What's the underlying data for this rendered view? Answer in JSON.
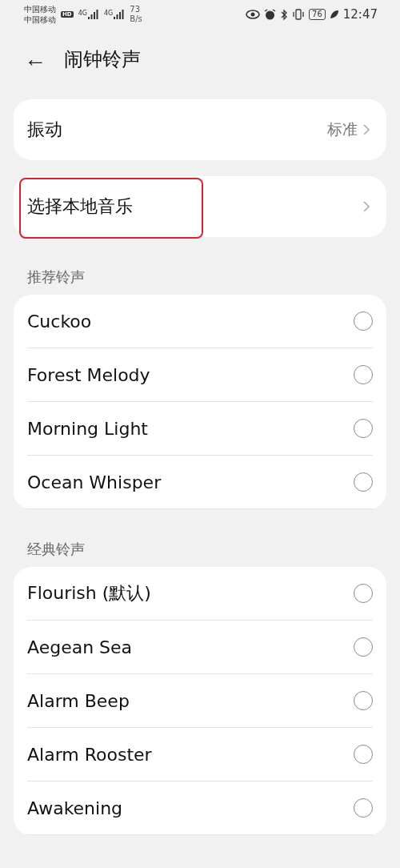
{
  "status_bar": {
    "carriers": [
      "中国移动",
      "中国移动"
    ],
    "hd_badge": "HD",
    "networks": [
      "4G",
      "4G"
    ],
    "speed_value": "73",
    "speed_unit": "B/s",
    "battery": "76",
    "time": "12:47"
  },
  "header": {
    "back": "←",
    "title": "闹钟铃声"
  },
  "settings": [
    {
      "label": "振动",
      "value": "标准",
      "highlighted": false
    },
    {
      "label": "选择本地音乐",
      "highlighted": true
    }
  ],
  "sections": [
    {
      "title": "推荐铃声",
      "items": [
        {
          "name": "Cuckoo",
          "selected": false
        },
        {
          "name": "Forest Melody",
          "selected": false
        },
        {
          "name": "Morning Light",
          "selected": false
        },
        {
          "name": "Ocean Whisper",
          "selected": false
        }
      ]
    },
    {
      "title": "经典铃声",
      "items": [
        {
          "name": "Flourish (默认)",
          "selected": false
        },
        {
          "name": "Aegean Sea",
          "selected": false
        },
        {
          "name": "Alarm Beep",
          "selected": false
        },
        {
          "name": "Alarm Rooster",
          "selected": false
        },
        {
          "name": "Awakening",
          "selected": false
        }
      ]
    }
  ]
}
